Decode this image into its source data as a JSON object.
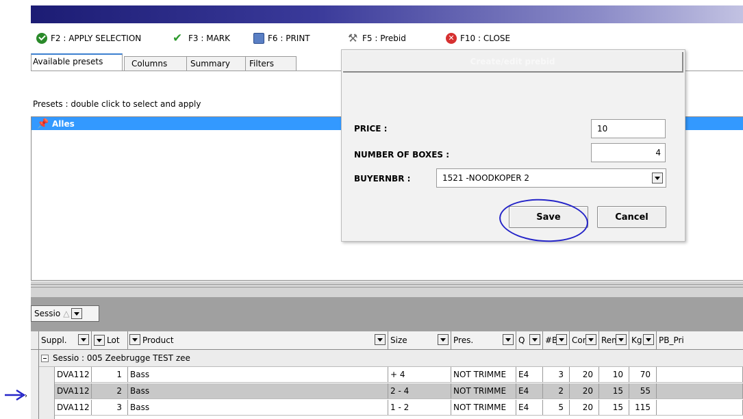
{
  "toolbar": {
    "apply_selection": "F2 : APPLY SELECTION",
    "mark": "F3 : MARK",
    "print": "F6 : PRINT",
    "prebid": "F5 : Prebid",
    "close": "F10 : CLOSE"
  },
  "tabs": [
    "Available presets",
    "Columns",
    "Summary",
    "Filters"
  ],
  "presets": {
    "hint": "Presets : double click to select and apply",
    "items": [
      "Alles"
    ]
  },
  "grouping": {
    "label": "Sessio",
    "sort_glyph": "△"
  },
  "grid": {
    "columns": [
      "Suppl.",
      "Lot",
      "Product",
      "Size",
      "Pres.",
      "Q",
      "#B",
      "Con",
      "Rem",
      "Kg",
      "PB_Pri"
    ],
    "group_row": "Sessio : 005 Zeebrugge TEST zee",
    "rows": [
      {
        "suppl": "DVA112",
        "lot": "1",
        "product": "Bass",
        "size": "+ 4",
        "pres": "NOT TRIMME",
        "q": "E4",
        "b": "3",
        "con": "20",
        "rem": "10",
        "kg": "70",
        "selected": false
      },
      {
        "suppl": "DVA112",
        "lot": "2",
        "product": "Bass",
        "size": "2 - 4",
        "pres": "NOT TRIMME",
        "q": "E4",
        "b": "2",
        "con": "20",
        "rem": "15",
        "kg": "55",
        "selected": true
      },
      {
        "suppl": "DVA112",
        "lot": "3",
        "product": "Bass",
        "size": "1 - 2",
        "pres": "NOT TRIMME",
        "q": "E4",
        "b": "5",
        "con": "20",
        "rem": "15",
        "kg": "115",
        "selected": false
      }
    ]
  },
  "dialog": {
    "title": "Create/edit prebid",
    "price_label": "PRICE :",
    "price_value": "10",
    "boxes_label": "NUMBER OF BOXES :",
    "boxes_value": "4",
    "buyer_label": "BUYERNBR :",
    "buyer_value": "1521 -NOODKOPER 2",
    "save_label": "Save",
    "cancel_label": "Cancel"
  },
  "colors": {
    "selection": "#3399ff",
    "annotation": "#2424c8"
  }
}
